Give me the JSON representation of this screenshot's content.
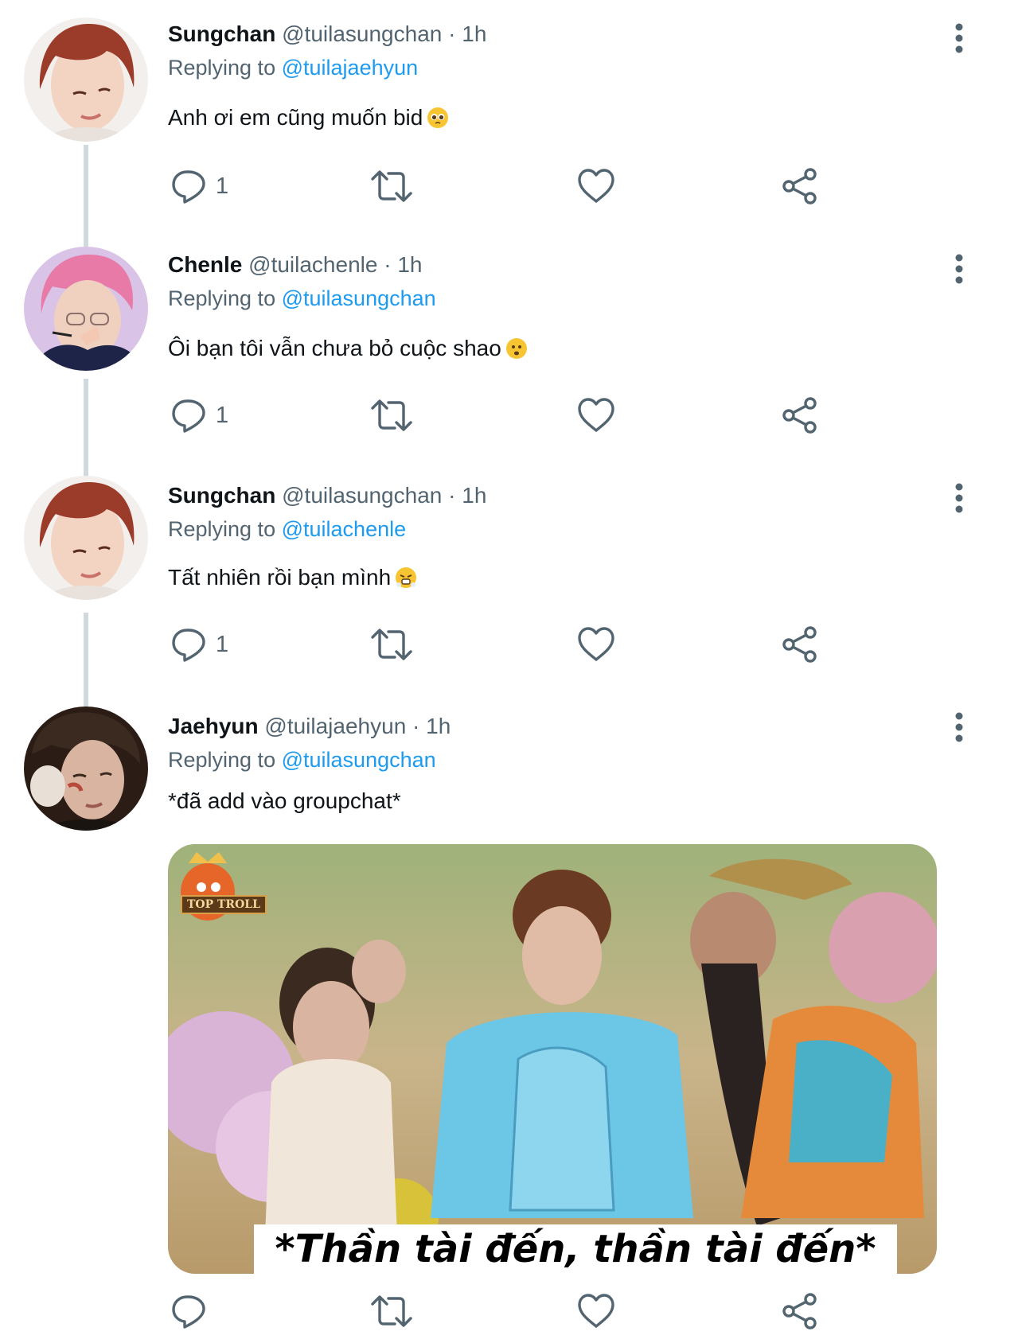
{
  "tweets": [
    {
      "name": "Sungchan",
      "handle": "@tuilasungchan",
      "dot": "·",
      "time": "1h",
      "replying_label": "Replying to",
      "replying_to": "@tuilajaehyun",
      "text": "Anh ơi em cũng muốn bid",
      "emoji": "pleading-face",
      "reply_count": "1"
    },
    {
      "name": "Chenle",
      "handle": "@tuilachenle",
      "dot": "·",
      "time": "1h",
      "replying_label": "Replying to",
      "replying_to": "@tuilasungchan",
      "text": "Ôi bạn tôi vẫn chưa bỏ cuộc shao",
      "emoji": "frowning-face",
      "reply_count": "1"
    },
    {
      "name": "Sungchan",
      "handle": "@tuilasungchan",
      "dot": "·",
      "time": "1h",
      "replying_label": "Replying to",
      "replying_to": "@tuilachenle",
      "text": "Tất nhiên rồi bạn mình",
      "emoji": "steam-from-nose-face",
      "reply_count": "1"
    },
    {
      "name": "Jaehyun",
      "handle": "@tuilajaehyun",
      "dot": "·",
      "time": "1h",
      "replying_label": "Replying to",
      "replying_to": "@tuilasungchan",
      "text": "*đã add vào groupchat*",
      "reply_count": ""
    }
  ],
  "media": {
    "caption": "*Thần tài đến, thần tài đến*",
    "watermark": "TOP TROLL"
  },
  "icons": {
    "reply": "speech-bubble-icon",
    "retweet": "retweet-icon",
    "like": "heart-icon",
    "share": "share-icon",
    "more": "vertical-ellipsis-icon"
  },
  "colors": {
    "text_primary": "#0f1419",
    "text_secondary": "#536471",
    "link": "#1d9bf0",
    "thread_line": "#cfd9de"
  }
}
